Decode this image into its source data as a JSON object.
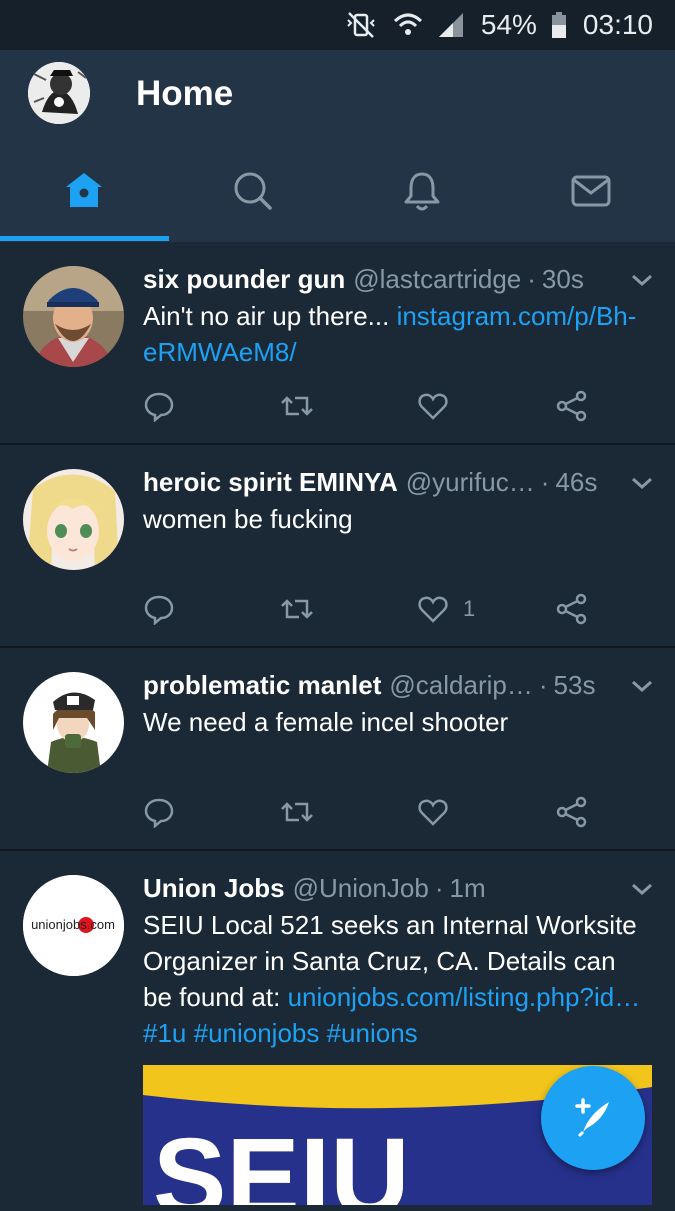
{
  "status_bar": {
    "battery": "54%",
    "time": "03:10"
  },
  "header": {
    "title": "Home",
    "tabs": [
      "home-icon",
      "search-icon",
      "bell-icon",
      "mail-icon"
    ],
    "active_tab": 0
  },
  "colors": {
    "background": "#1b2836",
    "header": "#243447",
    "accent": "#1da1f2",
    "muted": "#8899a6"
  },
  "tweets": [
    {
      "name": "six pounder gun",
      "handle": "@lastcartridge",
      "time": "30s",
      "text": "Ain't no air up there... ",
      "link": "instagram.com/p/Bh-eRMWAeM8/",
      "likes": ""
    },
    {
      "name": "heroic spirit EMINYA",
      "handle": "@yurifuc…",
      "time": "46s",
      "text": "women be fucking",
      "likes": "1"
    },
    {
      "name": "problematic manlet",
      "handle": "@caldarip…",
      "time": "53s",
      "text": "We need a female incel shooter",
      "likes": ""
    },
    {
      "name": "Union Jobs",
      "handle": "@UnionJob",
      "time": "1m",
      "text": "SEIU Local 521 seeks an Internal Worksite Organizer in Santa Cruz, CA. Details can be found at: ",
      "link": "unionjobs.com/listing.php?id…",
      "hashtags": "#1u #unionjobs #unions",
      "avatar_text": "unionjobs.com",
      "media_text": "SEIU"
    }
  ]
}
